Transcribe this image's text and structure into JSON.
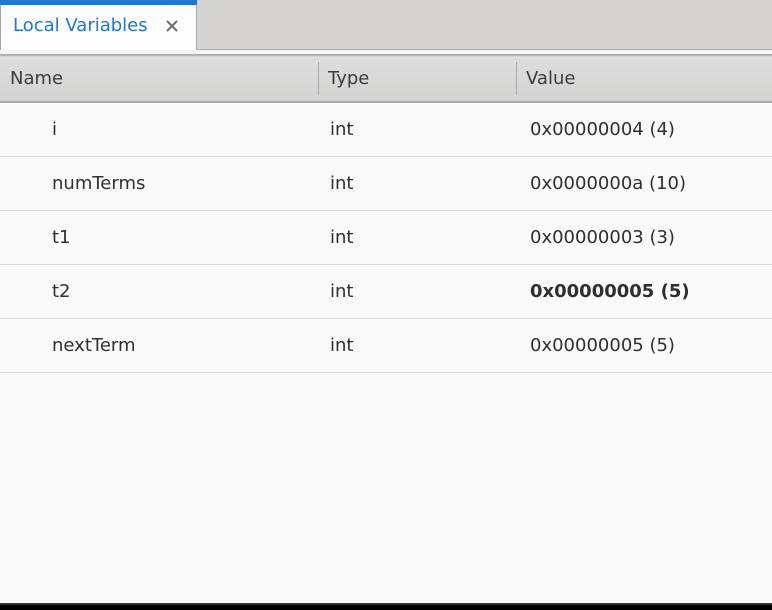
{
  "tab": {
    "label": "Local Variables"
  },
  "columns": {
    "name": "Name",
    "type": "Type",
    "value": "Value"
  },
  "rows": [
    {
      "name": "i",
      "type": "int",
      "value": "0x00000004 (4)",
      "highlight": false
    },
    {
      "name": "numTerms",
      "type": "int",
      "value": "0x0000000a (10)",
      "highlight": false
    },
    {
      "name": "t1",
      "type": "int",
      "value": "0x00000003 (3)",
      "highlight": false
    },
    {
      "name": "t2",
      "type": "int",
      "value": "0x00000005 (5)",
      "highlight": true
    },
    {
      "name": "nextTerm",
      "type": "int",
      "value": "0x00000005 (5)",
      "highlight": false
    }
  ]
}
